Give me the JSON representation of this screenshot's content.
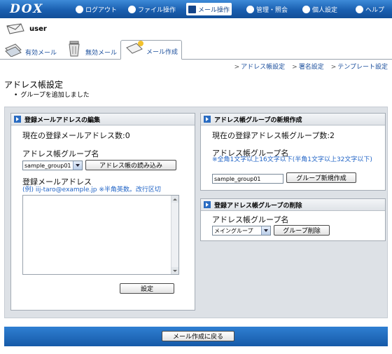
{
  "nav": {
    "logo": "DOX",
    "items": [
      {
        "label": "ログアウト",
        "icon": "power-icon"
      },
      {
        "label": "ファイル操作",
        "icon": "file-icon"
      },
      {
        "label": "メール操作",
        "icon": "mail-icon",
        "active": true
      },
      {
        "label": "管理・照会",
        "icon": "admin-icon"
      },
      {
        "label": "個人設定",
        "icon": "person-icon"
      },
      {
        "label": "ヘルプ",
        "icon": "help-icon"
      }
    ]
  },
  "user": {
    "name": "user"
  },
  "tabs": [
    {
      "label": "有効メール",
      "icon": "valid-mail-icon"
    },
    {
      "label": "無効メール",
      "icon": "trash-icon"
    },
    {
      "label": "メール作成",
      "icon": "compose-mail-icon",
      "active": true
    }
  ],
  "sublinks": [
    "アドレス帳設定",
    "署名設定",
    "テンプレート設定"
  ],
  "page": {
    "title": "アドレス帳設定",
    "message": "グループを追加しました"
  },
  "left_panel": {
    "header": "登録メールアドレスの編集",
    "count_text": "現在の登録メールアドレス数:0",
    "group_label": "アドレス帳グループ名",
    "group_select": "sample_group01",
    "load_button": "アドレス帳の読み込み",
    "address_label": "登録メールアドレス",
    "address_note": "(例) iij-taro@example.jp ※半角英数。改行区切",
    "submit_button": "設定"
  },
  "new_group_panel": {
    "header": "アドレス帳グループの新規作成",
    "count_text": "現在の登録アドレス帳グループ数:2",
    "name_label": "アドレス帳グループ名",
    "note": "※全角1文字以上16文字以下(半角1文字以上32文字以下)",
    "name_value": "sample_group01",
    "create_button": "グループ新規作成"
  },
  "delete_panel": {
    "header": "登録アドレス帳グループの削除",
    "name_label": "アドレス帳グループ名",
    "select_value": "メイングループ",
    "delete_button": "グループ削除"
  },
  "footer": {
    "back_button": "メール作成に戻る"
  },
  "colors": {
    "nav_blue": "#1a5fb0",
    "link_blue": "#1a4e9c",
    "note_blue": "#1f63c6",
    "panel_bg": "#dde1e6"
  }
}
